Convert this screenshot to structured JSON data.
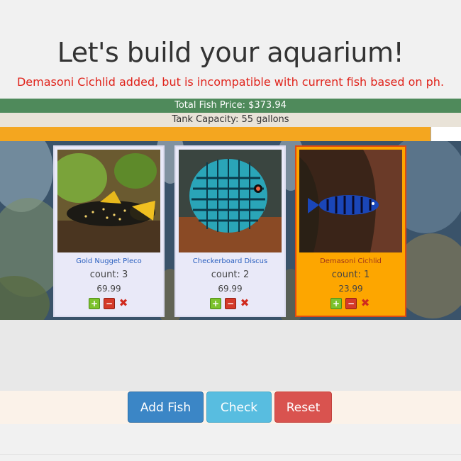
{
  "page": {
    "title": "Let's build your aquarium!",
    "warning": "Demasoni Cichlid added, but is incompatible with current fish based on ph."
  },
  "summary": {
    "total_price": "Total Fish Price: $373.94",
    "tank_capacity": "Tank Capacity: 55 gallons",
    "capacity_fill_percent": 93.4
  },
  "fish": [
    {
      "name": "Gold Nugget Pleco",
      "count": "count: 3",
      "price": "69.99",
      "selected": false,
      "photo_icon": "gold-nugget-pleco-photo"
    },
    {
      "name": "Checkerboard Discus",
      "count": "count: 2",
      "price": "69.99",
      "selected": false,
      "photo_icon": "checkerboard-discus-photo"
    },
    {
      "name": "Demasoni Cichlid",
      "count": "count: 1",
      "price": "23.99",
      "selected": true,
      "photo_icon": "demasoni-cichlid-photo"
    }
  ],
  "controls": {
    "plus": "+",
    "minus": "−",
    "remove": "✖"
  },
  "buttons": {
    "add": "Add Fish",
    "check": "Check",
    "reset": "Reset"
  },
  "colors": {
    "price_bar": "#4f8a5b",
    "capacity_fill": "#f4a61f",
    "selected_card": "#fda600",
    "warning_text": "#e0241c"
  }
}
